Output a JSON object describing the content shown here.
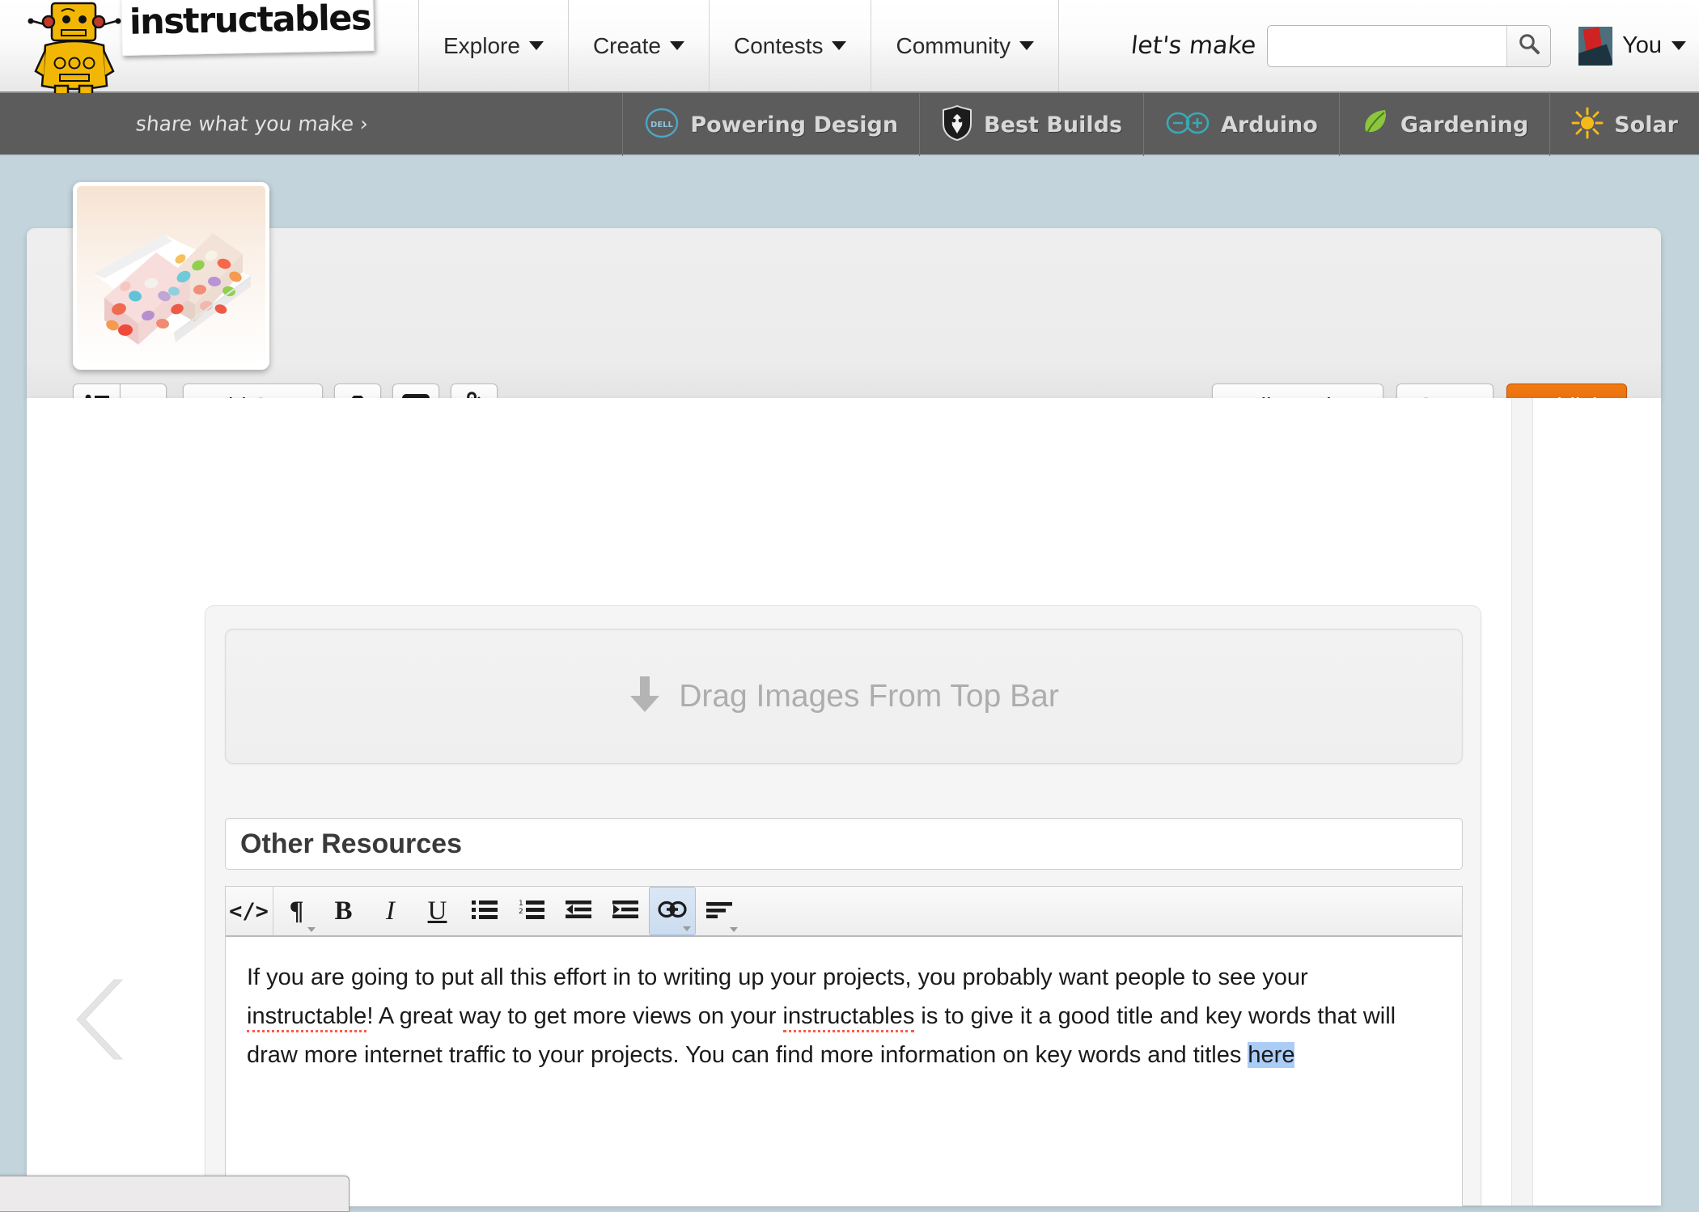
{
  "header": {
    "logo_text": "instructables",
    "logo_icon": "robot-mascot-icon",
    "nav": [
      {
        "label": "Explore",
        "icon": "chevron-down-icon"
      },
      {
        "label": "Create",
        "icon": "chevron-down-icon"
      },
      {
        "label": "Contests",
        "icon": "chevron-down-icon"
      },
      {
        "label": "Community",
        "icon": "chevron-down-icon"
      }
    ],
    "search": {
      "prompt": "let's make",
      "value": "",
      "placeholder": "",
      "button_icon": "search-icon"
    },
    "account": {
      "label": "You",
      "avatar_icon": "user-avatar",
      "caret_icon": "chevron-down-icon"
    }
  },
  "subnav": {
    "tagline": "share what you make  ›",
    "channels": [
      {
        "label": "Powering Design",
        "icon": "dell-logo-icon"
      },
      {
        "label": "Best Builds",
        "icon": "shield-icon"
      },
      {
        "label": "Arduino",
        "icon": "arduino-infinity-icon"
      },
      {
        "label": "Gardening",
        "icon": "leaf-icon"
      },
      {
        "label": "Solar",
        "icon": "sun-icon"
      }
    ]
  },
  "editor_bar": {
    "thumbnail_icon": "project-thumbnail-cereal-treats",
    "steps_list_icon": "bullet-list-icon",
    "steps_caret_icon": "chevron-down-icon",
    "add_step_label": "Add Step",
    "photo_icon": "camera-icon",
    "video_icon": "video-play-icon",
    "file_icon": "paperclip-icon",
    "full_preview_label": "Full Preview",
    "save_label": "Save",
    "publish_label": "Publish",
    "publish_color": "#e8690a"
  },
  "step": {
    "dropzone": {
      "icon": "down-arrow-icon",
      "label": "Drag Images From Top Bar"
    },
    "title": "Other Resources",
    "toolbar": [
      {
        "name": "source-code",
        "glyph": "</>",
        "kind": "code",
        "active": false,
        "caret": false
      },
      {
        "name": "paragraph-format",
        "glyph": "¶",
        "kind": "pilcrow",
        "active": false,
        "caret": true
      },
      {
        "name": "bold",
        "glyph": "B",
        "kind": "bold",
        "active": false,
        "caret": false
      },
      {
        "name": "italic",
        "glyph": "I",
        "kind": "italic",
        "active": false,
        "caret": false
      },
      {
        "name": "underline",
        "glyph": "U",
        "kind": "underline",
        "active": false,
        "caret": false
      },
      {
        "name": "unordered-list",
        "glyph": "",
        "kind": "ul",
        "active": false,
        "caret": false
      },
      {
        "name": "ordered-list",
        "glyph": "",
        "kind": "ol",
        "active": false,
        "caret": false
      },
      {
        "name": "outdent",
        "glyph": "",
        "kind": "outdent",
        "active": false,
        "caret": false
      },
      {
        "name": "indent",
        "glyph": "",
        "kind": "indent",
        "active": false,
        "caret": false
      },
      {
        "name": "insert-link",
        "glyph": "",
        "kind": "link",
        "active": true,
        "caret": true
      },
      {
        "name": "align",
        "glyph": "",
        "kind": "align",
        "active": false,
        "caret": true
      }
    ],
    "body": {
      "p1_a": "If you are going to put all this effort in to writing up your projects, you probably want people to see your ",
      "p1_misspelled": "instructable",
      "p1_b": "!",
      "p2_a": " A great way to get more views on your ",
      "p2_misspelled": "instructables",
      "p2_b": " is to give it a good title and key words that will draw more internet traffic to your projects.  You can find more information on key words and titles ",
      "p2_selected": "here"
    }
  },
  "nav_prev_icon": "chevron-left-icon",
  "colors": {
    "page_bg": "#c3d4dc",
    "subnav_bg": "#5c5c5c",
    "accent_orange": "#e8690a",
    "selection_blue": "#aaccf5",
    "spellcheck_red": "#ff5a4a"
  }
}
